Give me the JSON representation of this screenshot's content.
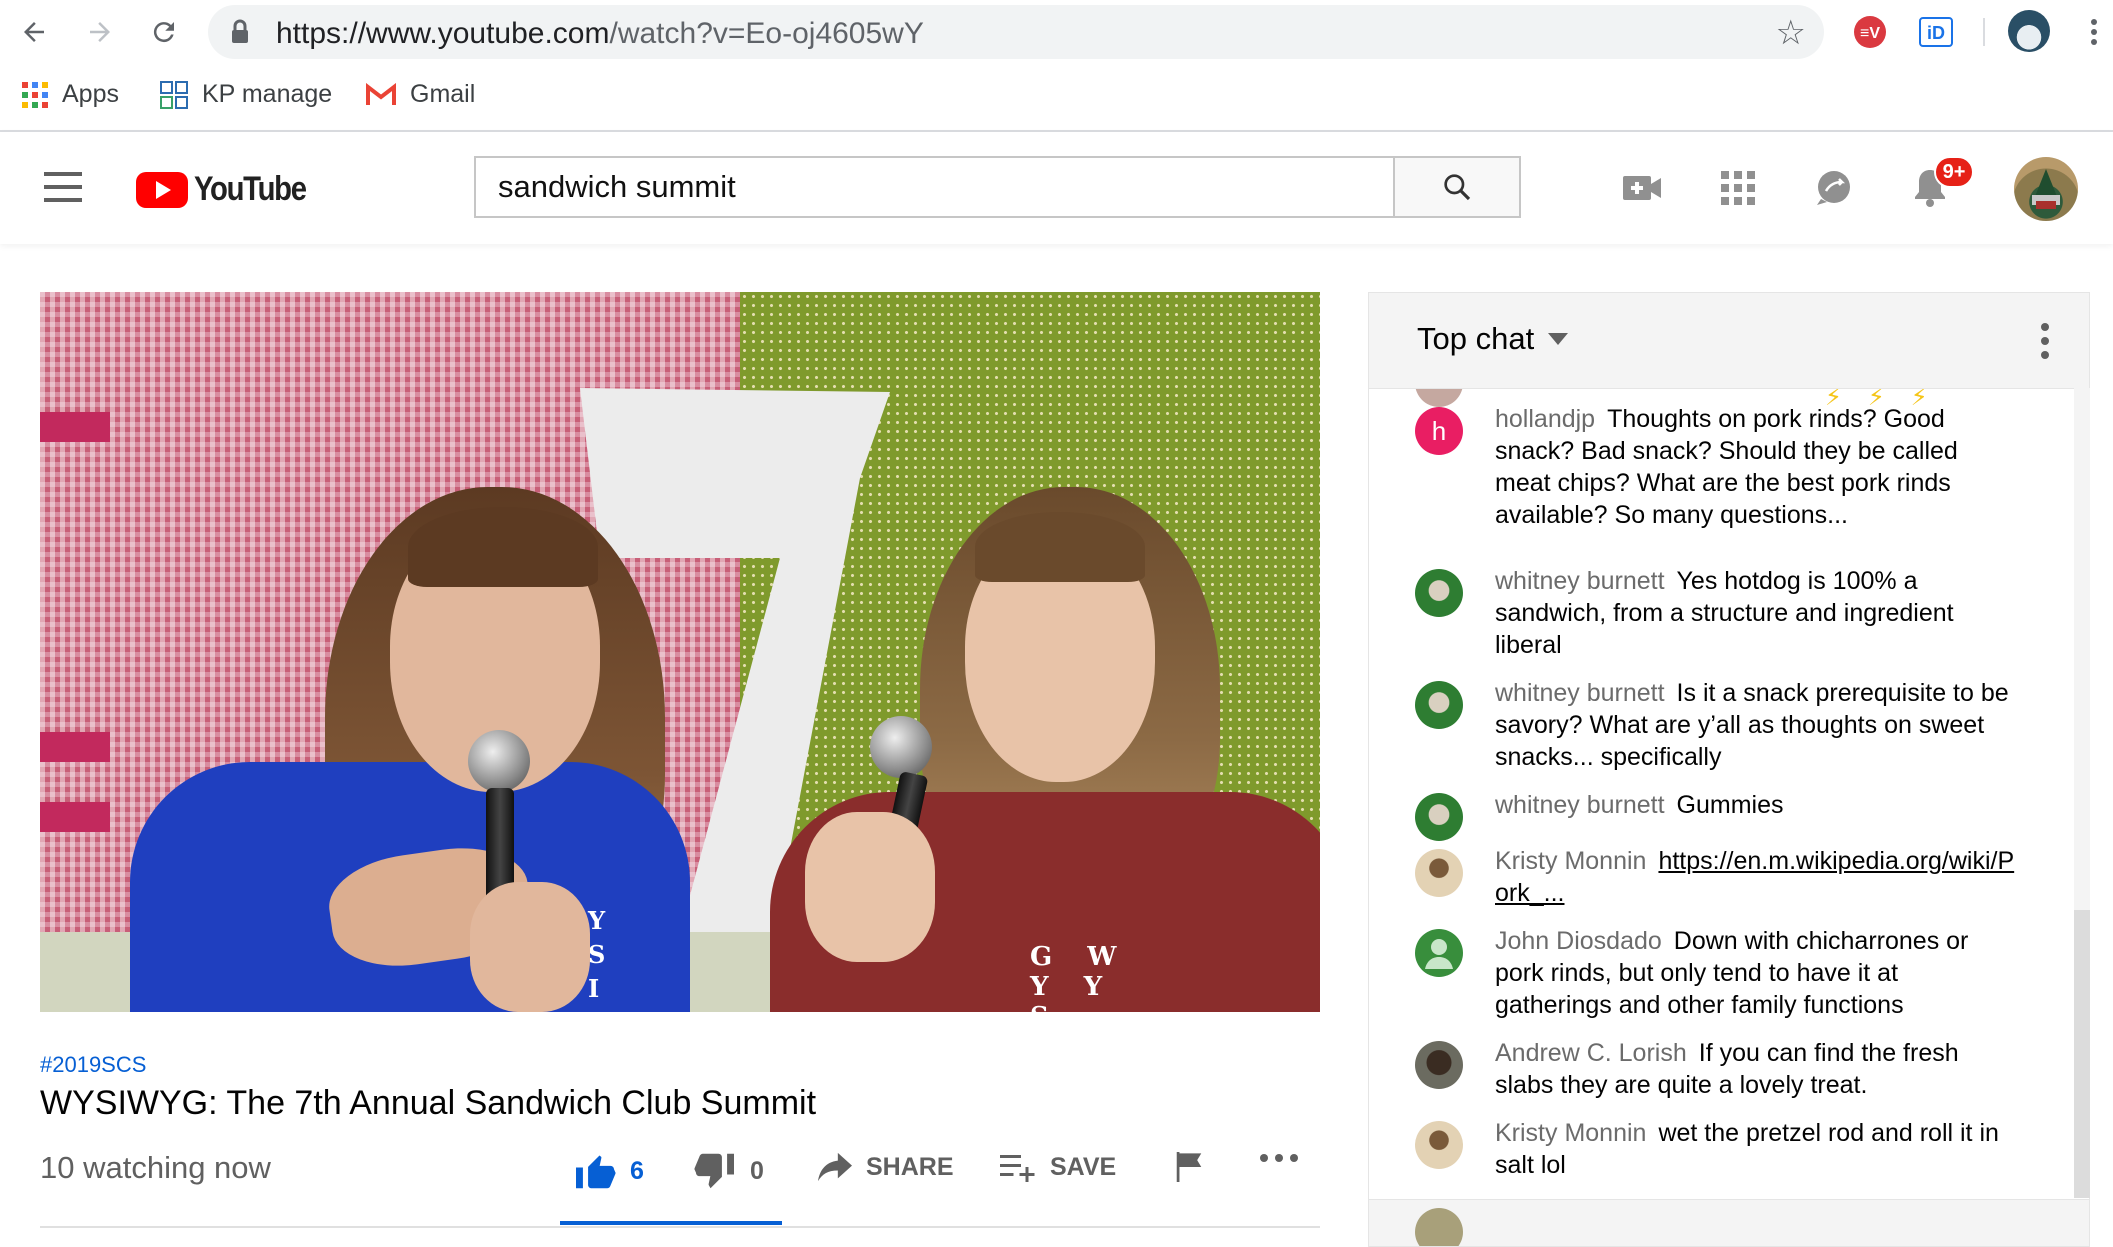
{
  "browser": {
    "url_host": "https://www.youtube.com",
    "url_path": "/watch?v=Eo-oj4605wY",
    "bookmarks": [
      {
        "label": "Apps"
      },
      {
        "label": "KP manage"
      },
      {
        "label": "Gmail"
      }
    ]
  },
  "masthead": {
    "logo_text": "YouTube",
    "search_value": "sandwich summit",
    "notification_badge": "9+"
  },
  "video": {
    "shirt_left_letters": "Y S I",
    "shirt_right_letters": "G W Y Y S",
    "hashtag": "#2019SCS",
    "title": "WYSIWYG: The 7th Annual Sandwich Club Summit",
    "watching": "10 watching now",
    "like_count": "6",
    "dislike_count": "0",
    "share_label": "SHARE",
    "save_label": "SAVE"
  },
  "chat": {
    "header_label": "Top chat",
    "messages": [
      {
        "author": "hollandjp",
        "text": "Thoughts on pork rinds? Good snack? Bad snack? Should they be called meat chips? What are the best pork rinds available? So many questions...",
        "avatar_letter": "h"
      },
      {
        "author": "whitney burnett",
        "text": "Yes hotdog is 100% a sandwich, from a structure and ingredient liberal"
      },
      {
        "author": "whitney burnett",
        "text": "Is it a snack prerequisite to be savory? What are y’all as thoughts on sweet snacks... specifically"
      },
      {
        "author": "whitney burnett",
        "text": "Gummies"
      },
      {
        "author": "Kristy Monnin",
        "link": "https://en.m.wikipedia.org/wiki/Pork_..."
      },
      {
        "author": "John Diosdado",
        "text": "Down with chicharrones or pork rinds, but only tend to have it at gatherings and other family functions"
      },
      {
        "author": "Andrew C. Lorish",
        "text": "If you can find the fresh slabs they are quite a lovely treat."
      },
      {
        "author": "Kristy Monnin",
        "text": "wet the pretzel rod and roll it in salt lol"
      }
    ]
  },
  "colors": {
    "accent_blue": "#065fd4",
    "youtube_red": "#ff0000",
    "badge_red": "#e62117"
  }
}
